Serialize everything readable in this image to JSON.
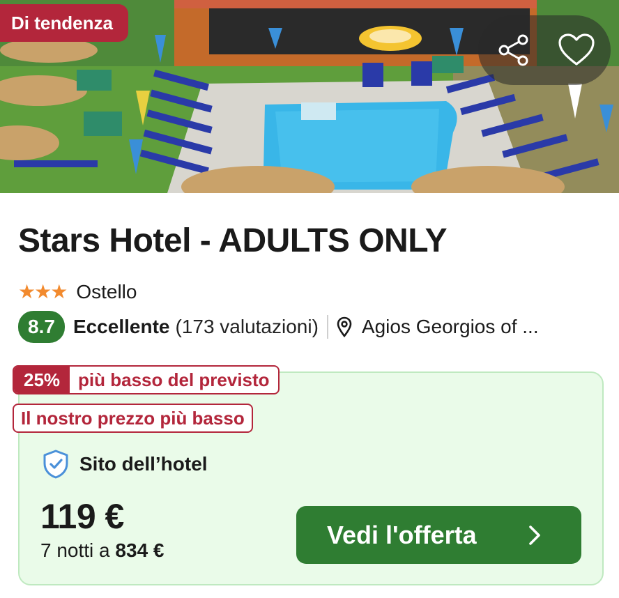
{
  "badge": {
    "label": "Di tendenza"
  },
  "hero": {
    "icons": [
      "share-icon",
      "heart-icon"
    ]
  },
  "hotel": {
    "name": "Stars Hotel - ADULTS ONLY",
    "stars": 3,
    "stars_glyphs": "★★★",
    "type": "Ostello",
    "score": "8.7",
    "rating_word": "Eccellente",
    "rating_count": "(173 valutazioni)",
    "location": "Agios Georgios of ..."
  },
  "deal": {
    "discount_pct": "25%",
    "discount_text": "più basso del previsto",
    "lowest_price_tag": "Il nostro prezzo più basso",
    "provider": "Sito dell’hotel",
    "price": "119 €",
    "nights_prefix": "7 notti a",
    "total": "834 €",
    "cta_label": "Vedi l'offerta"
  },
  "colors": {
    "accent_red": "#b3263b",
    "score_green": "#2f7d32",
    "cta_green": "#2f7d32",
    "deal_bg": "#eafbe9",
    "star_orange": "#f28a2e",
    "shield_blue": "#4a90d9"
  }
}
